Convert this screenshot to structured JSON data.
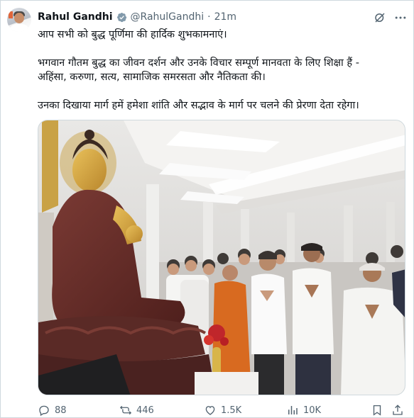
{
  "author": {
    "name": "Rahul Gandhi",
    "handle": "@RahulGandhi",
    "separator": "·",
    "time": "21m"
  },
  "tweet": {
    "line1": "आप सभी को बुद्ध पूर्णिमा की हार्दिक शुभकामनाएं।",
    "line2": "भगवान गौतम बुद्ध का जीवन दर्शन और उनके विचार सम्पूर्ण मानवता के लिए शिक्षा हैं -",
    "line3": "अहिंसा, करुणा, सत्य, सामाजिक समरसता और नैतिकता की।",
    "line4": "उनका दिखाया मार्ग हमें हमेशा शांति और सद्भाव के मार्ग पर चलने की प्रेरणा देता रहेगा।"
  },
  "actions": {
    "replies": "88",
    "reposts": "446",
    "likes": "1.5K",
    "views": "10K"
  },
  "icons": [
    "verified-icon",
    "grok-icon",
    "more-icon",
    "reply-icon",
    "repost-icon",
    "like-icon",
    "views-icon",
    "bookmark-icon",
    "share-icon"
  ],
  "colors": {
    "text": "#0f1419",
    "secondary": "#536471",
    "verified": "#829aab",
    "border": "#cfd9de"
  }
}
